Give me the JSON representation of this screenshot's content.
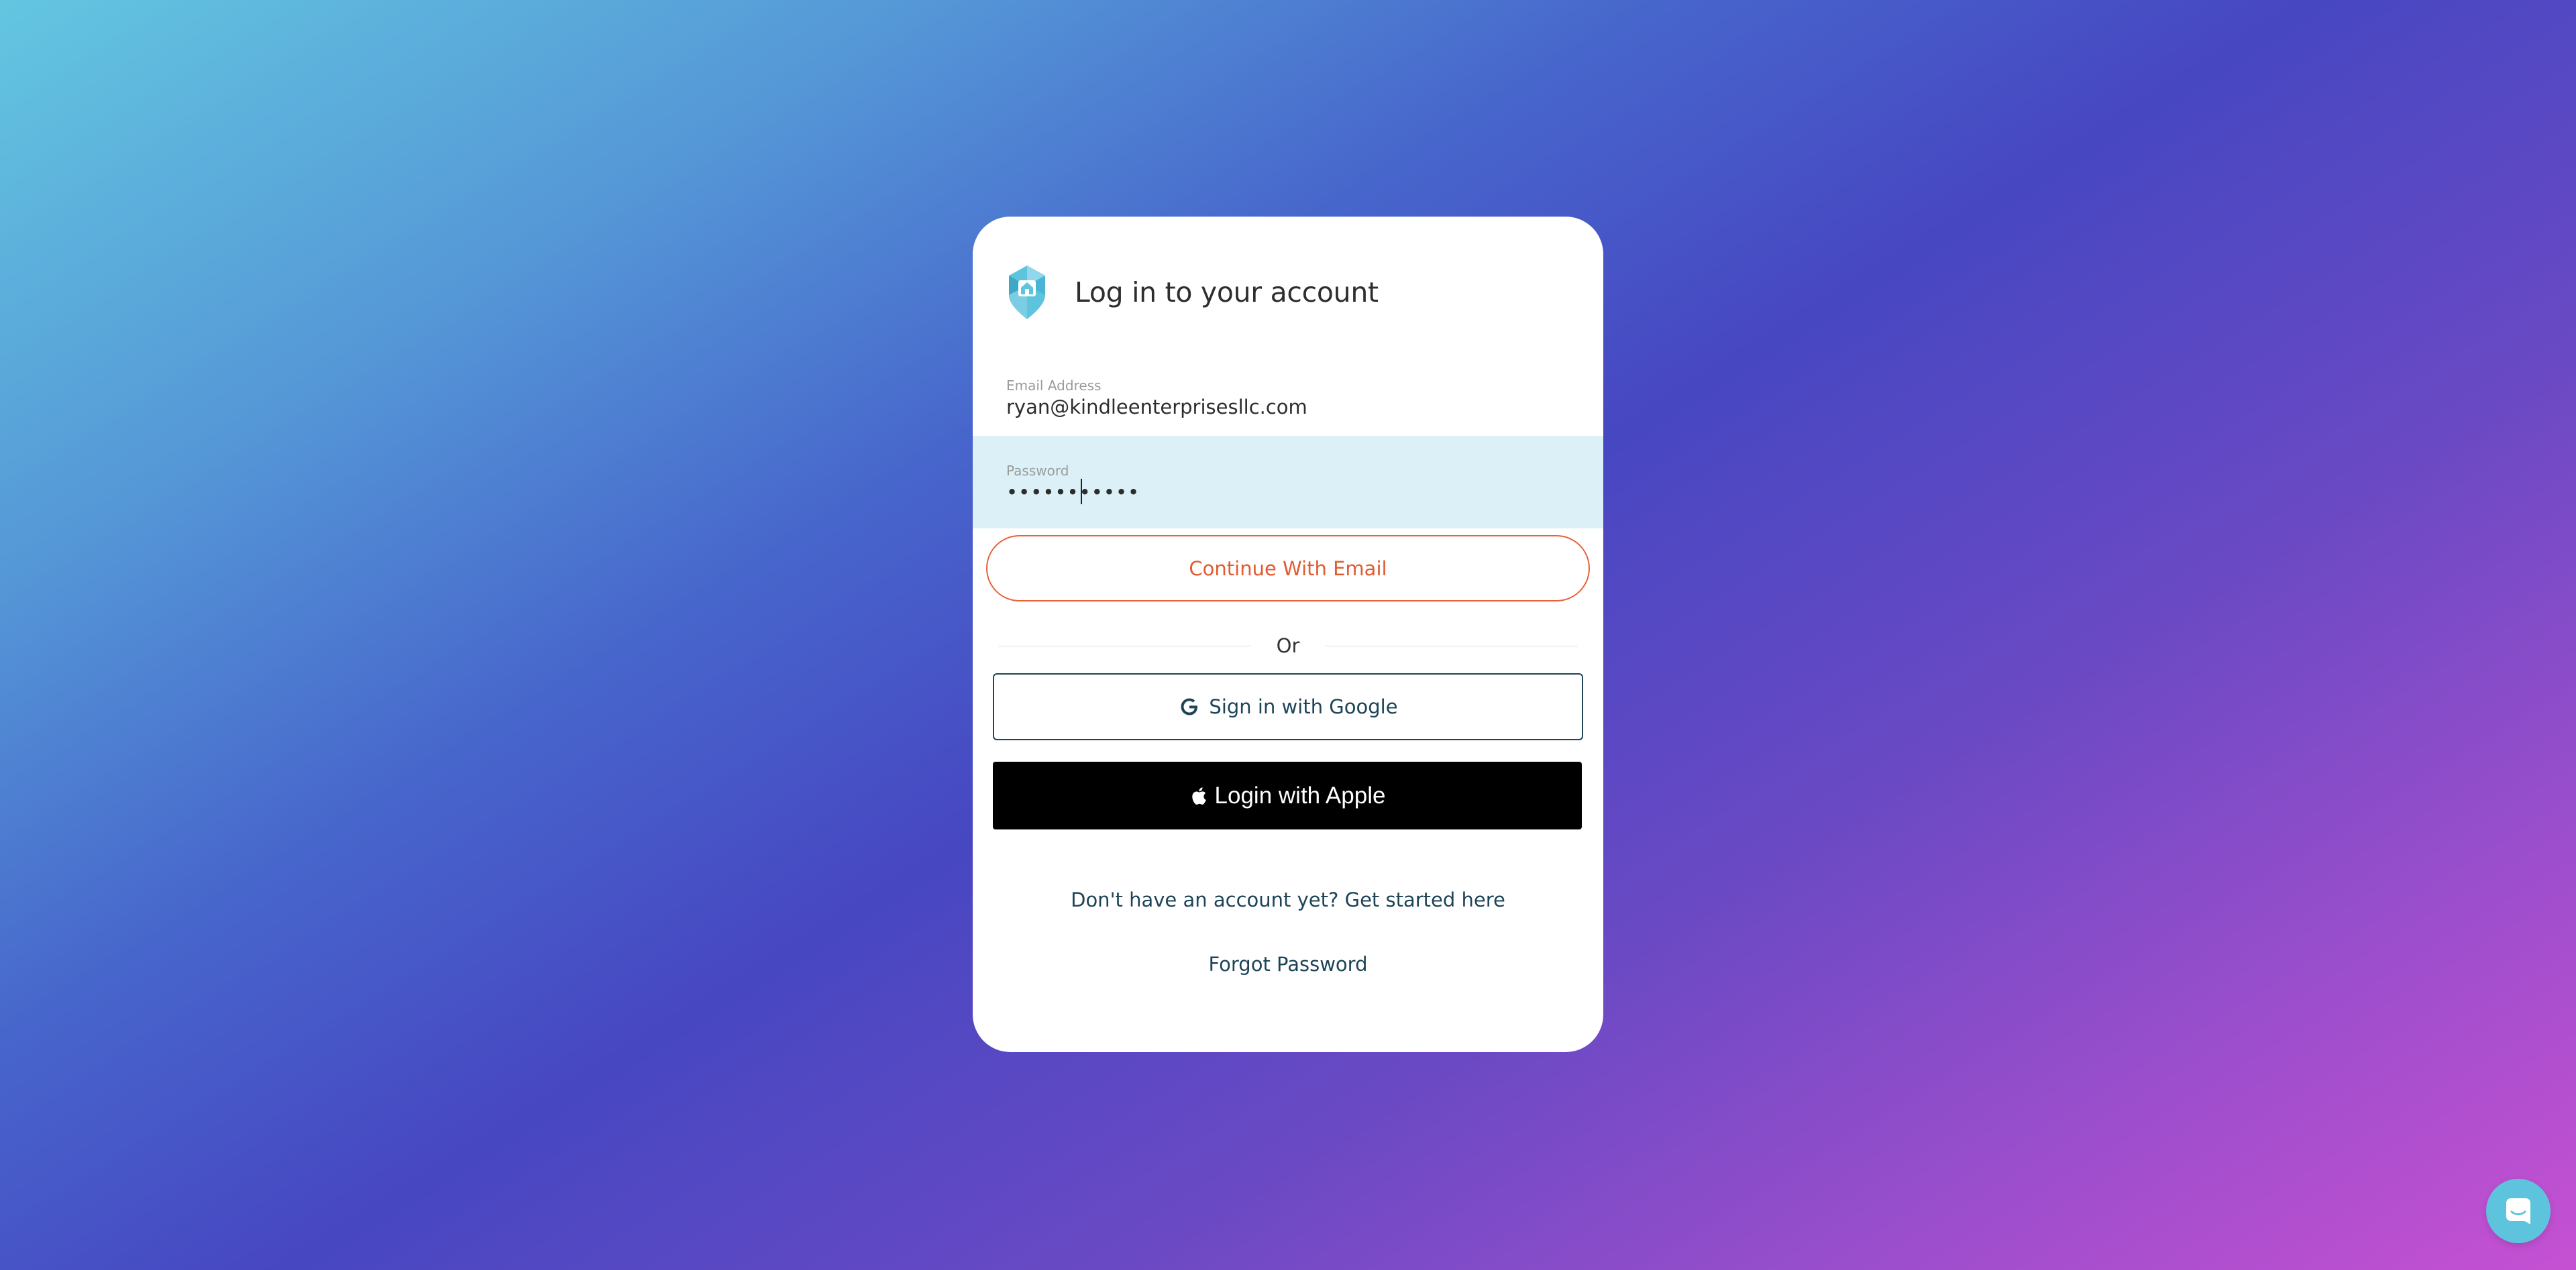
{
  "login": {
    "title": "Log in to your account",
    "email": {
      "label": "Email Address",
      "value": "ryan@kindleenterprisesllc.com"
    },
    "password": {
      "label": "Password",
      "value": "•••••••••••"
    },
    "continue_label": "Continue With Email",
    "divider_text": "Or",
    "google_label": "Sign in with Google",
    "apple_label": "Login with Apple",
    "signup_link": "Don't have an account yet? Get started here",
    "forgot_link": "Forgot Password"
  },
  "icons": {
    "logo": "house-location-pin-logo",
    "google": "google-g-icon",
    "apple": "apple-icon",
    "chat": "chat-bubble-icon"
  },
  "colors": {
    "accent": "#e8623a",
    "brand": "#5ec4dd",
    "link": "#1d4457",
    "password_field_bg": "#dbf1f7"
  }
}
